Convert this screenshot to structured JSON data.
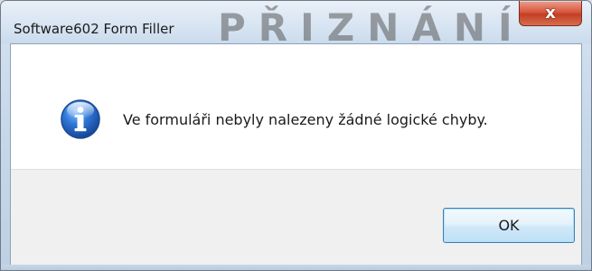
{
  "window": {
    "title": "Software602 Form Filler",
    "background_watermark": "PŘIZNÁNÍ",
    "close_label": "x"
  },
  "dialog": {
    "icon": "info-icon",
    "message": "Ve formuláři nebyly nalezeny žádné logické chyby.",
    "ok_label": "OK"
  },
  "colors": {
    "close_button": "#c94a30",
    "ok_button_border": "#3c7fb1",
    "info_icon": "#1f5bb5",
    "button_strip": "#f0f0f0"
  }
}
